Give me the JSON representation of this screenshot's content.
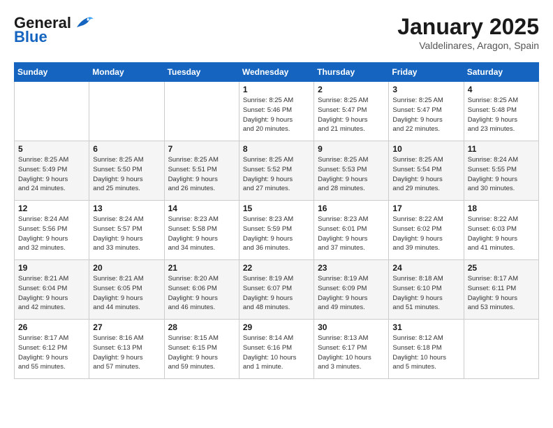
{
  "header": {
    "logo_general": "General",
    "logo_blue": "Blue",
    "month": "January 2025",
    "location": "Valdelinares, Aragon, Spain"
  },
  "weekdays": [
    "Sunday",
    "Monday",
    "Tuesday",
    "Wednesday",
    "Thursday",
    "Friday",
    "Saturday"
  ],
  "weeks": [
    [
      {
        "day": "",
        "info": ""
      },
      {
        "day": "",
        "info": ""
      },
      {
        "day": "",
        "info": ""
      },
      {
        "day": "1",
        "info": "Sunrise: 8:25 AM\nSunset: 5:46 PM\nDaylight: 9 hours\nand 20 minutes."
      },
      {
        "day": "2",
        "info": "Sunrise: 8:25 AM\nSunset: 5:47 PM\nDaylight: 9 hours\nand 21 minutes."
      },
      {
        "day": "3",
        "info": "Sunrise: 8:25 AM\nSunset: 5:47 PM\nDaylight: 9 hours\nand 22 minutes."
      },
      {
        "day": "4",
        "info": "Sunrise: 8:25 AM\nSunset: 5:48 PM\nDaylight: 9 hours\nand 23 minutes."
      }
    ],
    [
      {
        "day": "5",
        "info": "Sunrise: 8:25 AM\nSunset: 5:49 PM\nDaylight: 9 hours\nand 24 minutes."
      },
      {
        "day": "6",
        "info": "Sunrise: 8:25 AM\nSunset: 5:50 PM\nDaylight: 9 hours\nand 25 minutes."
      },
      {
        "day": "7",
        "info": "Sunrise: 8:25 AM\nSunset: 5:51 PM\nDaylight: 9 hours\nand 26 minutes."
      },
      {
        "day": "8",
        "info": "Sunrise: 8:25 AM\nSunset: 5:52 PM\nDaylight: 9 hours\nand 27 minutes."
      },
      {
        "day": "9",
        "info": "Sunrise: 8:25 AM\nSunset: 5:53 PM\nDaylight: 9 hours\nand 28 minutes."
      },
      {
        "day": "10",
        "info": "Sunrise: 8:25 AM\nSunset: 5:54 PM\nDaylight: 9 hours\nand 29 minutes."
      },
      {
        "day": "11",
        "info": "Sunrise: 8:24 AM\nSunset: 5:55 PM\nDaylight: 9 hours\nand 30 minutes."
      }
    ],
    [
      {
        "day": "12",
        "info": "Sunrise: 8:24 AM\nSunset: 5:56 PM\nDaylight: 9 hours\nand 32 minutes."
      },
      {
        "day": "13",
        "info": "Sunrise: 8:24 AM\nSunset: 5:57 PM\nDaylight: 9 hours\nand 33 minutes."
      },
      {
        "day": "14",
        "info": "Sunrise: 8:23 AM\nSunset: 5:58 PM\nDaylight: 9 hours\nand 34 minutes."
      },
      {
        "day": "15",
        "info": "Sunrise: 8:23 AM\nSunset: 5:59 PM\nDaylight: 9 hours\nand 36 minutes."
      },
      {
        "day": "16",
        "info": "Sunrise: 8:23 AM\nSunset: 6:01 PM\nDaylight: 9 hours\nand 37 minutes."
      },
      {
        "day": "17",
        "info": "Sunrise: 8:22 AM\nSunset: 6:02 PM\nDaylight: 9 hours\nand 39 minutes."
      },
      {
        "day": "18",
        "info": "Sunrise: 8:22 AM\nSunset: 6:03 PM\nDaylight: 9 hours\nand 41 minutes."
      }
    ],
    [
      {
        "day": "19",
        "info": "Sunrise: 8:21 AM\nSunset: 6:04 PM\nDaylight: 9 hours\nand 42 minutes."
      },
      {
        "day": "20",
        "info": "Sunrise: 8:21 AM\nSunset: 6:05 PM\nDaylight: 9 hours\nand 44 minutes."
      },
      {
        "day": "21",
        "info": "Sunrise: 8:20 AM\nSunset: 6:06 PM\nDaylight: 9 hours\nand 46 minutes."
      },
      {
        "day": "22",
        "info": "Sunrise: 8:19 AM\nSunset: 6:07 PM\nDaylight: 9 hours\nand 48 minutes."
      },
      {
        "day": "23",
        "info": "Sunrise: 8:19 AM\nSunset: 6:09 PM\nDaylight: 9 hours\nand 49 minutes."
      },
      {
        "day": "24",
        "info": "Sunrise: 8:18 AM\nSunset: 6:10 PM\nDaylight: 9 hours\nand 51 minutes."
      },
      {
        "day": "25",
        "info": "Sunrise: 8:17 AM\nSunset: 6:11 PM\nDaylight: 9 hours\nand 53 minutes."
      }
    ],
    [
      {
        "day": "26",
        "info": "Sunrise: 8:17 AM\nSunset: 6:12 PM\nDaylight: 9 hours\nand 55 minutes."
      },
      {
        "day": "27",
        "info": "Sunrise: 8:16 AM\nSunset: 6:13 PM\nDaylight: 9 hours\nand 57 minutes."
      },
      {
        "day": "28",
        "info": "Sunrise: 8:15 AM\nSunset: 6:15 PM\nDaylight: 9 hours\nand 59 minutes."
      },
      {
        "day": "29",
        "info": "Sunrise: 8:14 AM\nSunset: 6:16 PM\nDaylight: 10 hours\nand 1 minute."
      },
      {
        "day": "30",
        "info": "Sunrise: 8:13 AM\nSunset: 6:17 PM\nDaylight: 10 hours\nand 3 minutes."
      },
      {
        "day": "31",
        "info": "Sunrise: 8:12 AM\nSunset: 6:18 PM\nDaylight: 10 hours\nand 5 minutes."
      },
      {
        "day": "",
        "info": ""
      }
    ]
  ]
}
